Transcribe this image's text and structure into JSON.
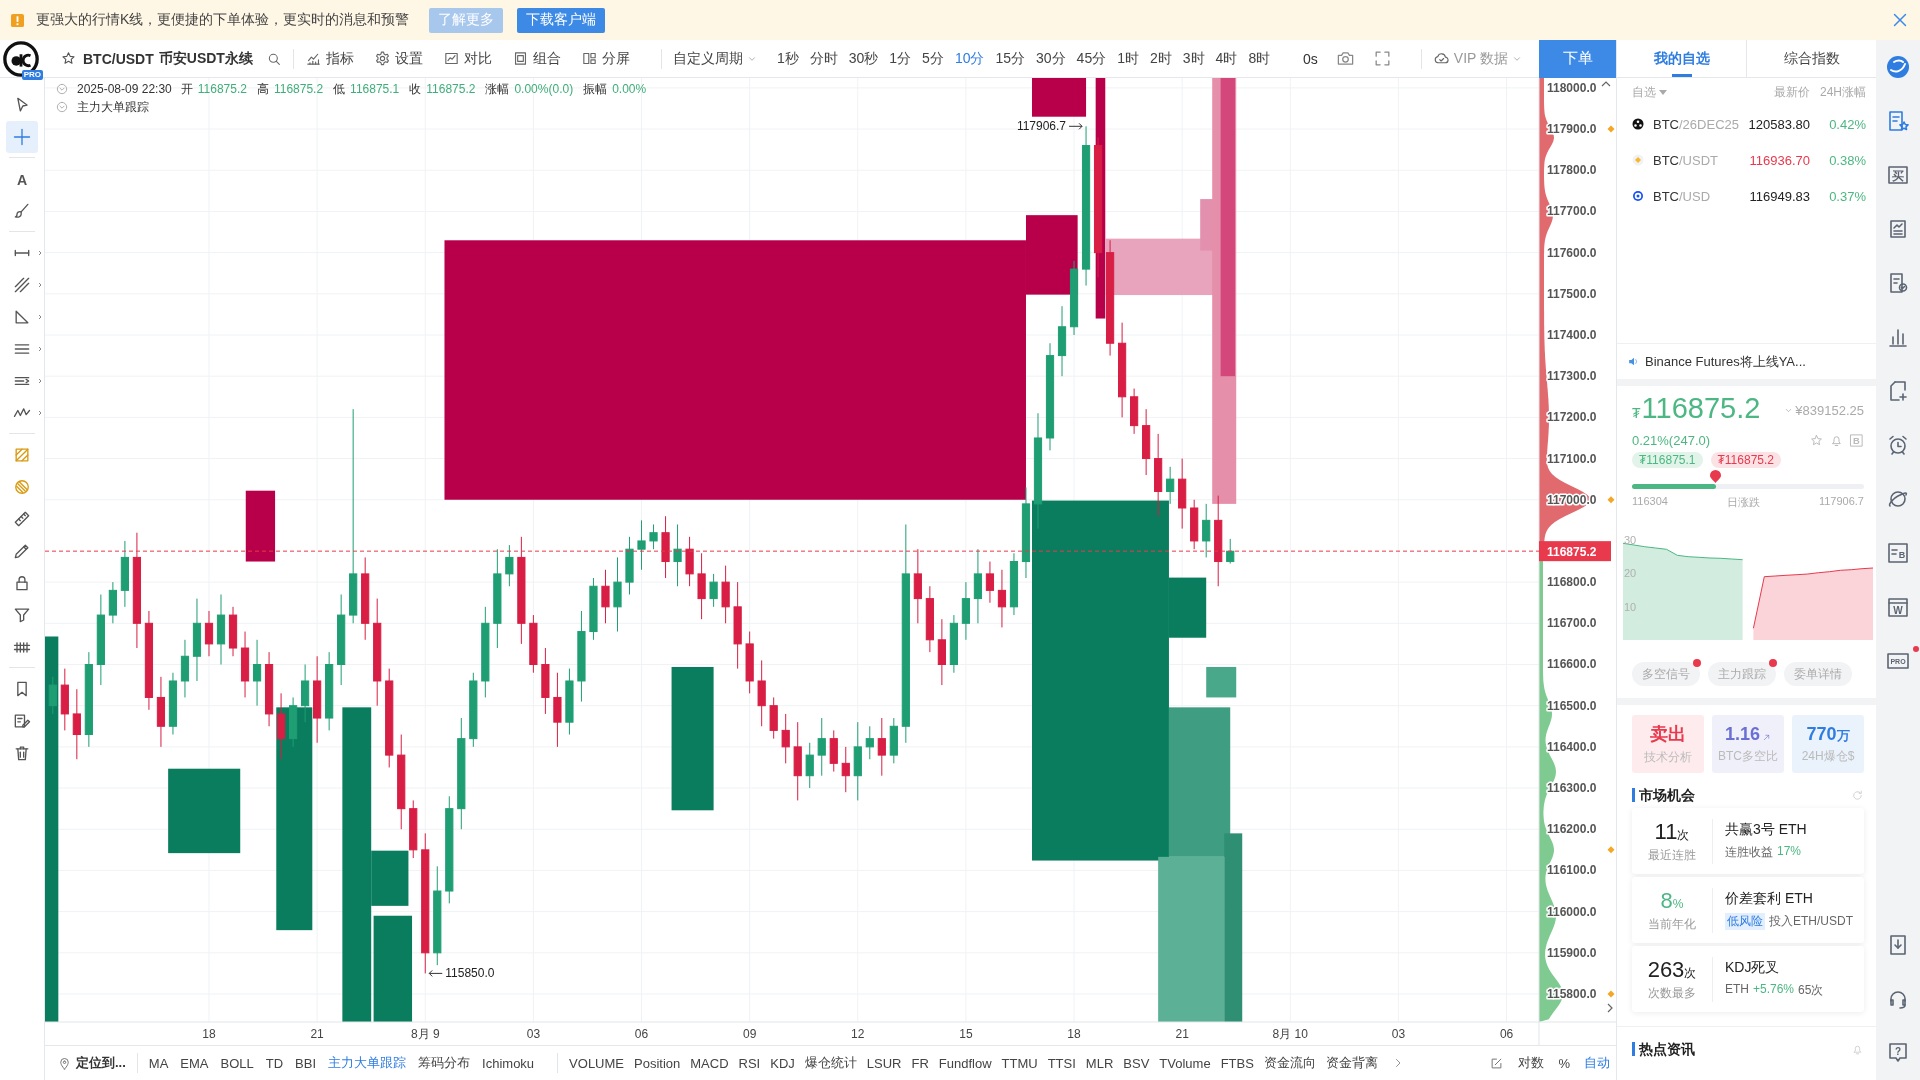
{
  "notice": {
    "text": "更强大的行情K线，更便捷的下单体验，更实时的消息和预警",
    "buttons": [
      {
        "label": "了解更多",
        "kind": "secondary"
      },
      {
        "label": "下载客户端",
        "kind": "primary"
      }
    ]
  },
  "toolbar": {
    "logo_badge": "PRO",
    "symbol": "BTC/USDT",
    "market": "币安USDT永续",
    "tools": [
      {
        "kind": "indicator",
        "label": "指标"
      },
      {
        "kind": "settings",
        "label": "设置"
      },
      {
        "kind": "compare",
        "label": "对比"
      },
      {
        "kind": "combine",
        "label": "组合"
      },
      {
        "kind": "split",
        "label": "分屏"
      }
    ],
    "custom_period": "自定义周期",
    "periods": [
      {
        "label": "1秒",
        "selected": false
      },
      {
        "label": "分时",
        "selected": false
      },
      {
        "label": "30秒",
        "selected": false
      },
      {
        "label": "1分",
        "selected": false
      },
      {
        "label": "5分",
        "selected": false
      },
      {
        "label": "10分",
        "selected": true
      },
      {
        "label": "15分",
        "selected": false
      },
      {
        "label": "30分",
        "selected": false
      },
      {
        "label": "45分",
        "selected": false
      },
      {
        "label": "1时",
        "selected": false
      },
      {
        "label": "2时",
        "selected": false
      },
      {
        "label": "3时",
        "selected": false
      },
      {
        "label": "4时",
        "selected": false
      },
      {
        "label": "8时",
        "selected": false
      }
    ],
    "countdown": "0s",
    "vip": "VIP 数据",
    "order_button": "下单"
  },
  "left_tools": [
    {
      "tools": [
        {
          "kind": "cursor",
          "selected": false
        },
        {
          "kind": "crosshair",
          "selected": true
        }
      ]
    },
    {
      "tools": [
        {
          "kind": "text",
          "glyph": "A",
          "selected": false
        },
        {
          "kind": "brush",
          "selected": false
        }
      ]
    },
    {
      "tools": [
        {
          "kind": "line",
          "selected": false
        },
        {
          "kind": "fib",
          "selected": false
        },
        {
          "kind": "triangle",
          "selected": false
        },
        {
          "kind": "parallel",
          "selected": false
        },
        {
          "kind": "channel",
          "selected": false
        },
        {
          "kind": "wave",
          "selected": false
        }
      ]
    },
    {
      "tools": [
        {
          "kind": "hatch",
          "selected": false
        },
        {
          "kind": "hatch_alt",
          "selected": false
        },
        {
          "kind": "ruler",
          "selected": false
        },
        {
          "kind": "pencil",
          "selected": false
        },
        {
          "kind": "lock",
          "selected": false
        },
        {
          "kind": "filter",
          "selected": false
        },
        {
          "kind": "pattern",
          "selected": false
        }
      ]
    },
    {
      "tools": [
        {
          "kind": "bookmark",
          "selected": false
        },
        {
          "kind": "editlist",
          "selected": false
        },
        {
          "kind": "trash",
          "selected": false
        }
      ]
    }
  ],
  "chart": {
    "legend": {
      "time": "2025-08-09 22:30",
      "fields": [
        {
          "label": "开",
          "value": "116875.2"
        },
        {
          "label": "高",
          "value": "116875.2"
        },
        {
          "label": "低",
          "value": "116875.1"
        },
        {
          "label": "收",
          "value": "116875.2"
        },
        {
          "label": "涨幅",
          "value": "0.00%(0.0)"
        },
        {
          "label": "振幅",
          "value": "0.00%"
        }
      ],
      "overlay": "主力大单跟踪"
    },
    "price_axis": [
      "118000.0",
      "117900.0",
      "117800.0",
      "117700.0",
      "117600.0",
      "117500.0",
      "117400.0",
      "117300.0",
      "117200.0",
      "117100.0",
      "117000.0",
      "116800.0",
      "116700.0",
      "116600.0",
      "116500.0",
      "116400.0",
      "116300.0",
      "116200.0",
      "116100.0",
      "116000.0",
      "115900.0",
      "115800.0"
    ],
    "time_axis": [
      "18",
      "21",
      "8月 9",
      "03",
      "06",
      "09",
      "12",
      "15",
      "18",
      "21",
      "8月 10",
      "03",
      "06"
    ],
    "price_tag": "116875.2",
    "high_label": "117906.7",
    "low_label": "115850.0"
  },
  "indicator_bar": {
    "locate": "定位到...",
    "main": [
      {
        "label": "MA",
        "selected": false
      },
      {
        "label": "EMA",
        "selected": false
      },
      {
        "label": "BOLL",
        "selected": false
      },
      {
        "label": "TD",
        "selected": false
      },
      {
        "label": "BBI",
        "selected": false
      },
      {
        "label": "主力大单跟踪",
        "selected": true
      },
      {
        "label": "筹码分布",
        "selected": false
      },
      {
        "label": "Ichimoku",
        "selected": false
      }
    ],
    "sub": [
      {
        "label": "VOLUME",
        "selected": false
      },
      {
        "label": "Position",
        "selected": false
      },
      {
        "label": "MACD",
        "selected": false
      },
      {
        "label": "RSI",
        "selected": false
      },
      {
        "label": "KDJ",
        "selected": false
      },
      {
        "label": "爆仓统计",
        "selected": false
      },
      {
        "label": "LSUR",
        "selected": false
      },
      {
        "label": "FR",
        "selected": false
      },
      {
        "label": "Fundflow",
        "selected": false
      },
      {
        "label": "TTMU",
        "selected": false
      },
      {
        "label": "TTSI",
        "selected": false
      },
      {
        "label": "MLR",
        "selected": false
      },
      {
        "label": "BSV",
        "selected": false
      },
      {
        "label": "TVolume",
        "selected": false
      },
      {
        "label": "FTBS",
        "selected": false
      },
      {
        "label": "资金流向",
        "selected": false
      },
      {
        "label": "资金背离",
        "selected": false
      }
    ],
    "options": [
      {
        "label": "对数",
        "selected": false
      },
      {
        "label": "%",
        "selected": false
      },
      {
        "label": "自动",
        "selected": true
      }
    ]
  },
  "right_panel": {
    "tabs": [
      {
        "label": "我的自选",
        "selected": true
      },
      {
        "label": "综合指数",
        "selected": false
      }
    ],
    "list_header": {
      "filter": "自选",
      "price": "最新价",
      "change": "24H涨幅"
    },
    "watchlist": [
      {
        "kind": "wheel",
        "base": "BTC",
        "quote": "/26DEC25",
        "price": "120583.80",
        "color": "#222222",
        "change": "0.42%"
      },
      {
        "kind": "diamond",
        "base": "BTC",
        "quote": "/USDT",
        "price": "116936.70",
        "color": "#e8394d",
        "change": "0.38%"
      },
      {
        "kind": "ring",
        "base": "BTC",
        "quote": "/USD",
        "price": "116949.83",
        "color": "#222222",
        "change": "0.37%"
      }
    ],
    "news": "Binance Futures将上线YA...",
    "quote": {
      "currency": "₮",
      "price": "116875.2",
      "cny": "¥839152.25",
      "change": "0.21%(247.0)",
      "actions": [
        {
          "kind": "star"
        },
        {
          "kind": "bell"
        },
        {
          "kind": "bbox",
          "glyph": "B"
        }
      ],
      "bid": "₮116875.1",
      "ask": "₮116875.2"
    },
    "day_range": {
      "low": "116304",
      "label": "日涨跌",
      "high": "117906.7",
      "current": {
        "level": 0.36
      }
    },
    "depth_chart": {
      "axis_labels": [
        "30",
        "20",
        "10"
      ]
    },
    "signal_tabs": [
      {
        "label": "多空信号",
        "badge": true
      },
      {
        "label": "主力跟踪",
        "badge": true
      },
      {
        "label": "委单详情"
      }
    ],
    "stats": [
      {
        "value": "卖出",
        "caption": "技术分析",
        "color": "#e8394d",
        "rising": false
      },
      {
        "value": "1.16",
        "caption": "BTC多空比",
        "color": "#6a6fd4",
        "rising": true
      },
      {
        "value": "770",
        "unit": "万",
        "caption": "24H爆仓$",
        "color": "#2f7de1",
        "rising": false
      }
    ],
    "opportunities": {
      "title": "市场机会",
      "cards": [
        {
          "value": "11",
          "unit": "次",
          "highlight": false,
          "caption": "最近连胜",
          "title": "共赢3号 ETH",
          "detail": [
            {
              "kind": "plain",
              "text": "连胜收益"
            },
            {
              "kind": "gain",
              "text": "17%"
            }
          ]
        },
        {
          "value": "8",
          "unit": "%",
          "highlight": true,
          "caption": "当前年化",
          "title": "价差套利 ETH",
          "detail": [
            {
              "kind": "tag",
              "text": "低风险"
            },
            {
              "kind": "plain",
              "text": "投入ETH/USDT"
            }
          ]
        },
        {
          "value": "263",
          "unit": "次",
          "highlight": false,
          "caption": "次数最多",
          "title": "KDJ死叉",
          "detail": [
            {
              "kind": "plain",
              "text": "ETH"
            },
            {
              "kind": "gain",
              "text": "+5.76%"
            },
            {
              "kind": "plain",
              "text": "65次"
            }
          ]
        }
      ]
    },
    "hot_news": {
      "title": "热点资讯"
    }
  },
  "icon_strip": {
    "top": [
      {
        "kind": "brand"
      },
      {
        "kind": "watchlist",
        "selected": true
      },
      {
        "kind": "buy",
        "glyph": "买",
        "selected": false
      },
      {
        "kind": "chartdoc",
        "selected": false
      },
      {
        "kind": "checkdoc",
        "selected": false
      },
      {
        "kind": "bars",
        "selected": false
      },
      {
        "kind": "newdoc",
        "selected": false
      },
      {
        "kind": "alarm",
        "selected": false
      },
      {
        "kind": "planet",
        "selected": false
      },
      {
        "kind": "listb",
        "glyph": "B",
        "selected": false
      },
      {
        "kind": "window",
        "glyph": "W",
        "selected": false
      },
      {
        "kind": "pro",
        "glyph": "PRO",
        "selected": false,
        "badge": true
      }
    ],
    "bottom": [
      {
        "kind": "download",
        "selected": false
      },
      {
        "kind": "headset",
        "selected": false
      },
      {
        "kind": "help",
        "glyph": "?",
        "selected": false
      }
    ]
  }
}
